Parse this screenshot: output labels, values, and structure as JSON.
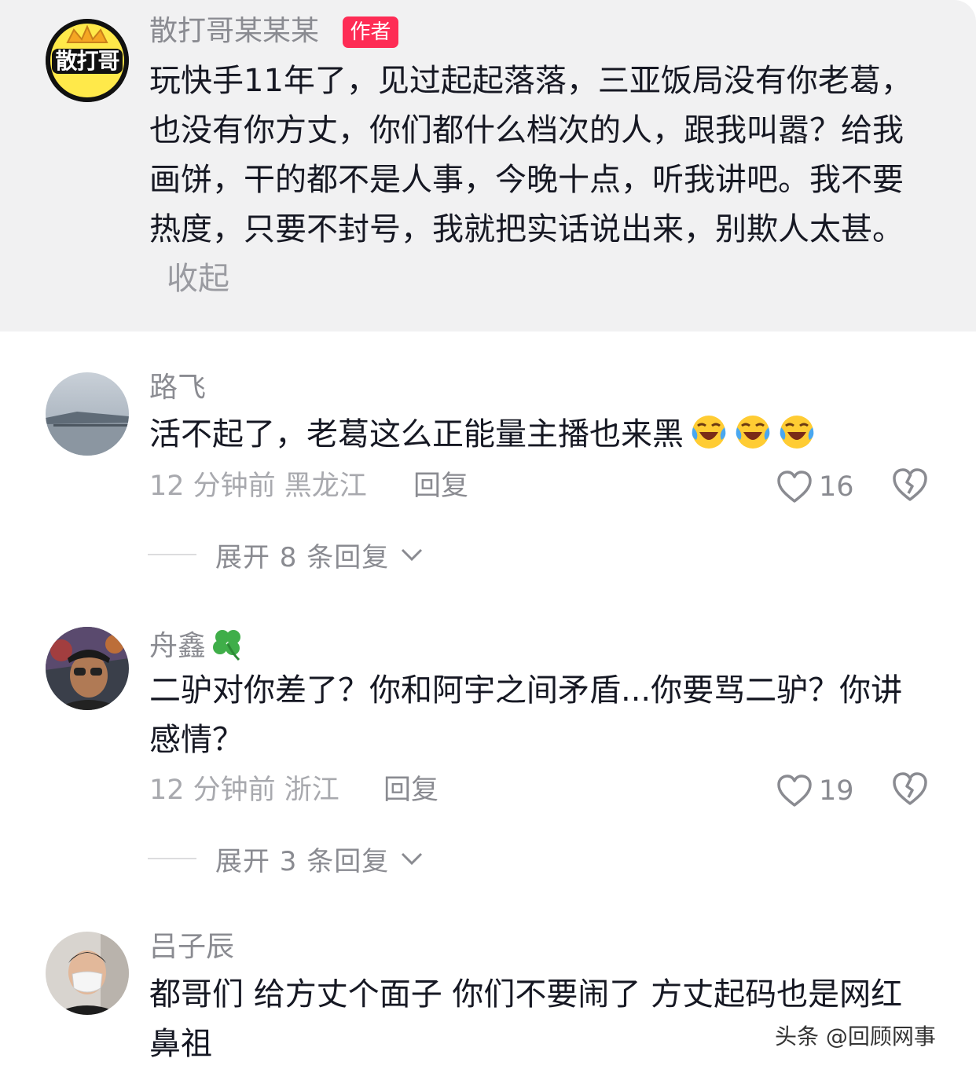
{
  "pinned_comment": {
    "username": "散打哥某某某",
    "badge": "作者",
    "avatar_text": "散打哥",
    "text": "玩快手11年了，见过起起落落，三亚饭局没有你老葛，也没有你方丈，你们都什么档次的人，跟我叫嚣？给我画饼，干的都不是人事，今晚十点，听我讲吧。我不要热度，只要不封号，我就把实话说出来，别欺人太甚。",
    "collapse_label": "收起"
  },
  "comments": [
    {
      "username": "路飞",
      "text": "活不起了，老葛这么正能量主播也来黑",
      "emoji": "laughing-crying-emoji",
      "time_location": "12 分钟前 黑龙江",
      "reply_label": "回复",
      "likes": "16",
      "expand_label": "展开 8 条回复"
    },
    {
      "username": "舟鑫",
      "username_emoji": "clover-emoji",
      "text": "二驴对你差了？你和阿宇之间矛盾...你要骂二驴？你讲感情？",
      "time_location": "12 分钟前 浙江",
      "reply_label": "回复",
      "likes": "19",
      "expand_label": "展开 3 条回复"
    },
    {
      "username": "吕子辰",
      "text": "都哥们 给方丈个面子 你们不要闹了 方丈起码也是网红鼻祖"
    }
  ],
  "watermark": "头条 @回顾网事",
  "colors": {
    "pinned_bg": "#f1f1f2",
    "badge": "#fe2c55",
    "text": "#161823",
    "muted": "#8a8b91"
  }
}
